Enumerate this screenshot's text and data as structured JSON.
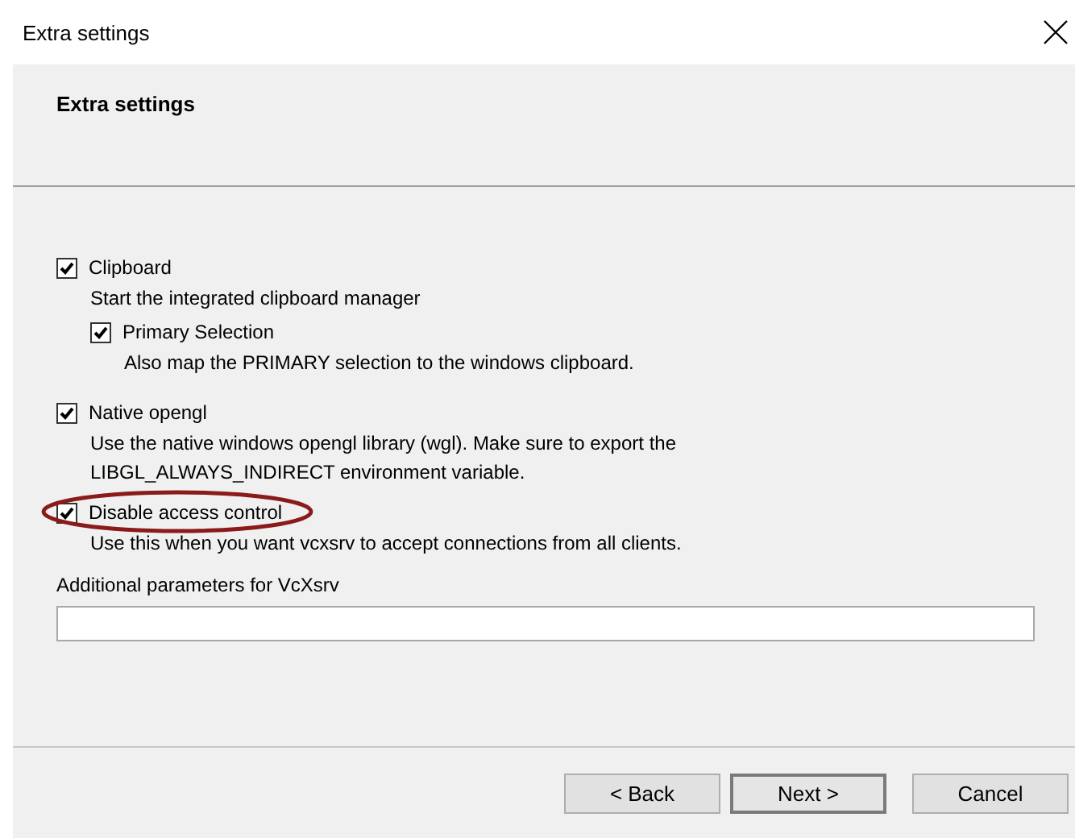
{
  "window": {
    "title": "Extra settings"
  },
  "header": {
    "title": "Extra settings"
  },
  "options": [
    {
      "label": "Clipboard",
      "checked": true,
      "circled": false,
      "description": "Start the integrated clipboard manager",
      "children": [
        {
          "label": "Primary Selection",
          "checked": true,
          "circled": false,
          "description": "Also map the PRIMARY selection to the windows clipboard."
        }
      ]
    },
    {
      "label": "Native opengl",
      "checked": true,
      "circled": false,
      "description": "Use the native windows opengl library (wgl). Make sure to export the LIBGL_ALWAYS_INDIRECT environment variable."
    },
    {
      "label": "Disable access control",
      "checked": true,
      "circled": true,
      "description": "Use this when you want vcxsrv to accept connections from all clients."
    }
  ],
  "parameters": {
    "label": "Additional parameters for VcXsrv"
  },
  "buttons": [
    {
      "label": "< Back",
      "default": false
    },
    {
      "label": "Next >",
      "default": true
    },
    {
      "label": "Cancel",
      "default": false
    }
  ]
}
